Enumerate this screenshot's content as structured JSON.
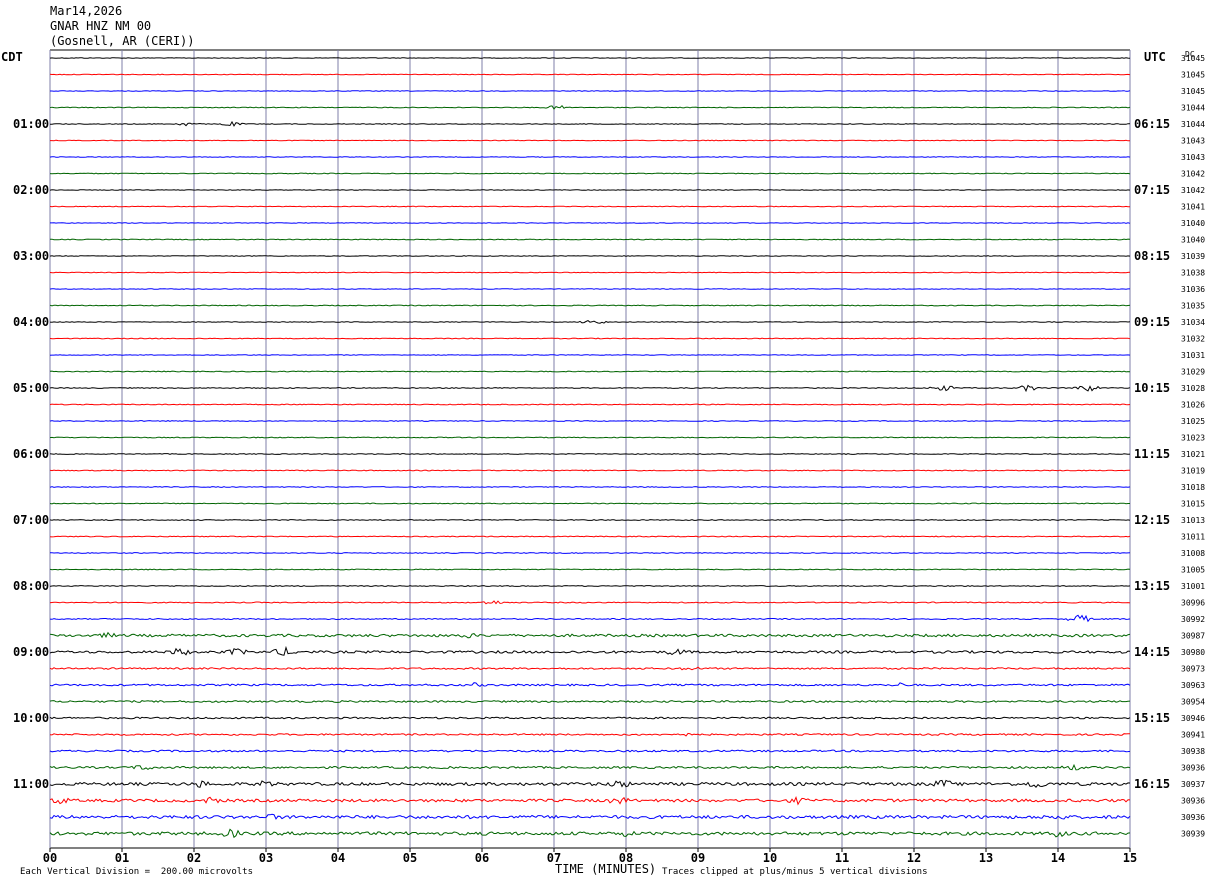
{
  "header": {
    "date": "Mar14,2026",
    "station": "GNAR HNZ NM 00",
    "location": "(Gosnell, AR (CERI))"
  },
  "labels": {
    "left_zone": "CDT",
    "right_zone": "UTC",
    "dc_label": "DC"
  },
  "footer": {
    "scale_note": "Each Vertical Division =  200.00 microvolts",
    "clip_note": "Traces clipped at plus/minus 5 vertical divisions"
  },
  "chart_data": {
    "type": "line",
    "title": "GNAR HNZ NM 00",
    "xlabel": "TIME (MINUTES)",
    "ylabel": "",
    "xlim": [
      0,
      15
    ],
    "x_ticks": [
      "00",
      "01",
      "02",
      "03",
      "04",
      "05",
      "06",
      "07",
      "08",
      "09",
      "10",
      "11",
      "12",
      "13",
      "14",
      "15"
    ],
    "grid": true,
    "trace_colors": [
      "#000000",
      "#ff0000",
      "#0000ff",
      "#006400"
    ],
    "left_hour_labels": [
      "01:00",
      "02:00",
      "03:00",
      "04:00",
      "05:00",
      "06:00",
      "07:00",
      "08:00",
      "09:00",
      "10:00",
      "11:00"
    ],
    "right_hour_labels": [
      "06:15",
      "07:15",
      "08:15",
      "09:15",
      "10:15",
      "11:15",
      "12:15",
      "13:15",
      "14:15",
      "15:15",
      "16:15"
    ],
    "dc_values": [
      "31045",
      "31045",
      "31045",
      "31044",
      "31044",
      "31043",
      "31043",
      "31042",
      "31042",
      "31041",
      "31040",
      "31040",
      "31039",
      "31038",
      "31036",
      "31035",
      "31034",
      "31032",
      "31031",
      "31029",
      "31028",
      "31026",
      "31025",
      "31023",
      "31021",
      "31019",
      "31018",
      "31015",
      "31013",
      "31011",
      "31008",
      "31005",
      "31001",
      "30996",
      "30992",
      "30987",
      "30980",
      "30973",
      "30963",
      "30954",
      "30946",
      "30941",
      "30938",
      "30936",
      "30937",
      "30936",
      "30936",
      "30939"
    ],
    "trace_noise": [
      0.3,
      0.35,
      0.3,
      0.4,
      0.35,
      0.35,
      0.3,
      0.4,
      0.3,
      0.35,
      0.3,
      0.4,
      0.3,
      0.35,
      0.3,
      0.45,
      0.3,
      0.4,
      0.3,
      0.45,
      0.45,
      0.45,
      0.4,
      0.45,
      0.4,
      0.45,
      0.4,
      0.45,
      0.45,
      0.45,
      0.4,
      0.45,
      0.45,
      0.5,
      0.55,
      1.3,
      1.2,
      0.8,
      0.9,
      0.9,
      0.8,
      0.8,
      0.9,
      1.0,
      1.5,
      1.4,
      1.6,
      1.6
    ],
    "events": [
      {
        "trace": 3,
        "minute": 7.05,
        "amp": 2.5
      },
      {
        "trace": 4,
        "minute": 1.9,
        "amp": 2.0
      },
      {
        "trace": 4,
        "minute": 2.5,
        "amp": 2.5
      },
      {
        "trace": 16,
        "minute": 7.55,
        "amp": 3.0
      },
      {
        "trace": 20,
        "minute": 12.4,
        "amp": 3.5
      },
      {
        "trace": 20,
        "minute": 13.6,
        "amp": 3.5
      },
      {
        "trace": 20,
        "minute": 14.4,
        "amp": 4.0
      },
      {
        "trace": 33,
        "minute": 6.15,
        "amp": 2.5
      },
      {
        "trace": 34,
        "minute": 14.3,
        "amp": 4.5
      },
      {
        "trace": 35,
        "minute": 0.8,
        "amp": 3.0
      },
      {
        "trace": 35,
        "minute": 5.8,
        "amp": 3.0
      },
      {
        "trace": 36,
        "minute": 1.8,
        "amp": 4.5
      },
      {
        "trace": 36,
        "minute": 2.6,
        "amp": 4.0
      },
      {
        "trace": 36,
        "minute": 3.25,
        "amp": 5.0
      },
      {
        "trace": 36,
        "minute": 8.7,
        "amp": 4.0
      },
      {
        "trace": 37,
        "minute": 8.9,
        "amp": 2.5
      },
      {
        "trace": 38,
        "minute": 5.9,
        "amp": 2.5
      },
      {
        "trace": 38,
        "minute": 11.8,
        "amp": 2.5
      },
      {
        "trace": 41,
        "minute": 8.75,
        "amp": 2.5
      },
      {
        "trace": 43,
        "minute": 1.3,
        "amp": 3.5
      },
      {
        "trace": 43,
        "minute": 14.2,
        "amp": 3.5
      },
      {
        "trace": 44,
        "minute": 2.1,
        "amp": 4.0
      },
      {
        "trace": 44,
        "minute": 3.0,
        "amp": 4.0
      },
      {
        "trace": 44,
        "minute": 7.9,
        "amp": 5.0
      },
      {
        "trace": 44,
        "minute": 12.4,
        "amp": 5.0
      },
      {
        "trace": 44,
        "minute": 13.7,
        "amp": 5.0
      },
      {
        "trace": 45,
        "minute": 0.15,
        "amp": 4.0
      },
      {
        "trace": 45,
        "minute": 2.25,
        "amp": 4.0
      },
      {
        "trace": 45,
        "minute": 7.9,
        "amp": 4.5
      },
      {
        "trace": 45,
        "minute": 10.4,
        "amp": 4.0
      },
      {
        "trace": 46,
        "minute": 3.1,
        "amp": 3.5
      },
      {
        "trace": 46,
        "minute": 14.0,
        "amp": 4.0
      },
      {
        "trace": 47,
        "minute": 2.5,
        "amp": 5.0
      },
      {
        "trace": 47,
        "minute": 8.0,
        "amp": 3.5
      },
      {
        "trace": 47,
        "minute": 14.0,
        "amp": 4.0
      }
    ]
  }
}
